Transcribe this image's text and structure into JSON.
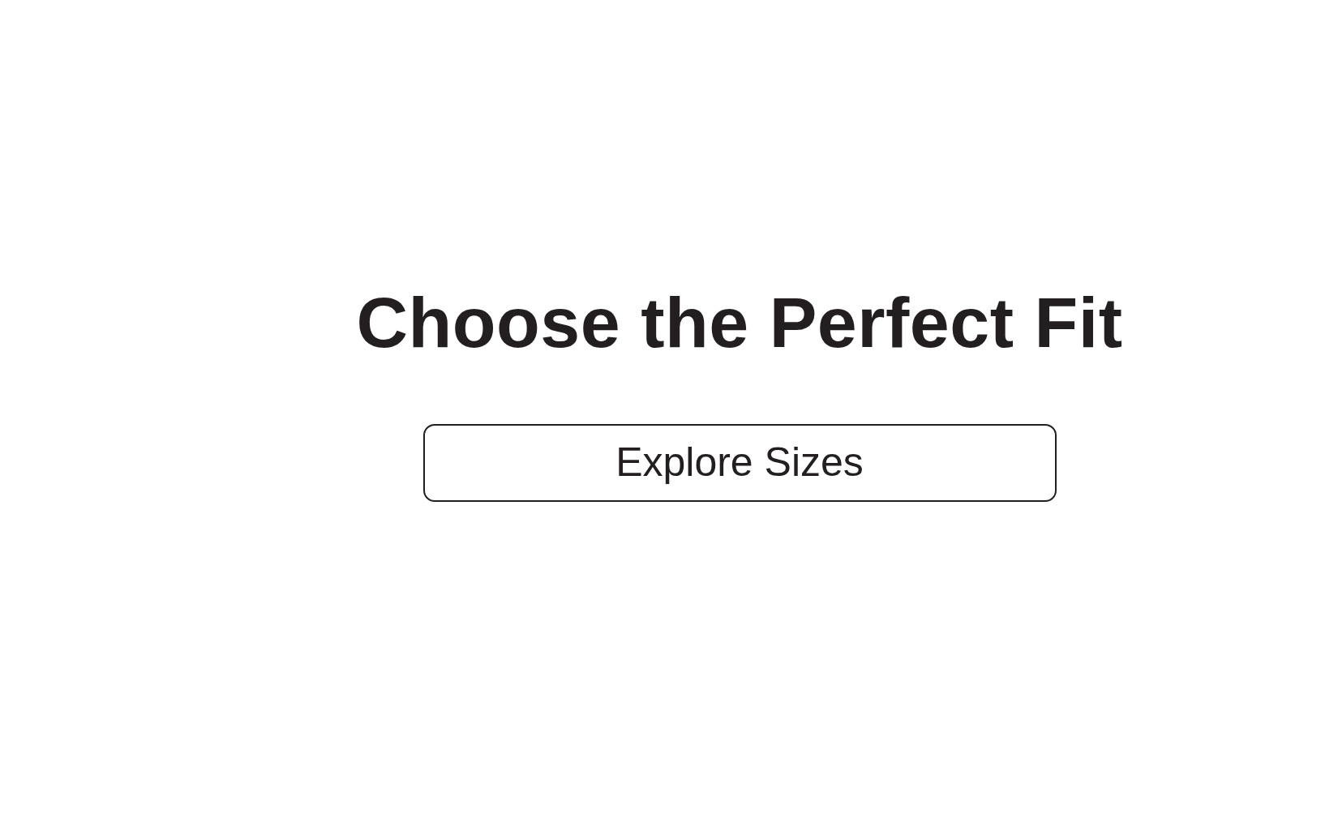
{
  "heading": "Choose the Perfect Fit",
  "button": {
    "label": "Explore Sizes"
  }
}
